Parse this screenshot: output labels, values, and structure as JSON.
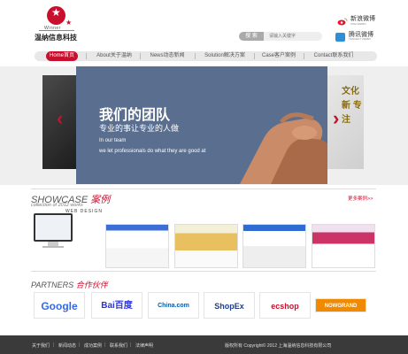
{
  "header": {
    "logo_english": "Winner",
    "logo_chinese": "温纳信息科技",
    "search_button": "搜 索",
    "search_placeholder": "请输入关键字",
    "weibo_label": "新浪微博",
    "weibo_sub": "SINA WEIBO",
    "tencent_label": "腾讯微博",
    "tencent_sub": "TENCENT WEIBO"
  },
  "nav": {
    "items": [
      {
        "label": "Home首页",
        "active": true
      },
      {
        "label": "About关于温纳"
      },
      {
        "label": "News动态新闻"
      },
      {
        "label": "Solution解决方案"
      },
      {
        "label": "Case客户案例"
      },
      {
        "label": "Contact联系我们"
      }
    ]
  },
  "banner": {
    "title": "我们的团队",
    "subtitle": "专业的事让专业的人做",
    "line1": "In our team",
    "line2": "we let professionals do what they are good at",
    "right_peek_text": "文化 新 专注",
    "prev_arrow": "‹",
    "next_arrow": "›"
  },
  "showcase": {
    "title_en": "SHOWCASE",
    "title_cn": "案例",
    "sub": "collection of 2012 works",
    "sub2": "WEB DESIGN",
    "more": "更多案例>>"
  },
  "partners": {
    "title_en": "PARTNERS",
    "title_cn": "合作伙伴",
    "logos": [
      "Google",
      "Bai百度",
      "China.com",
      "ShopEx",
      "ecshop",
      "NOWGRAND"
    ]
  },
  "footer": {
    "links": [
      "关于我们",
      "新闻动态",
      "成功案例",
      "联系我们",
      "法律声明"
    ],
    "copyright": "版权所有 Copyright© 2012 上海温纳信息科技有限公司"
  },
  "colors": {
    "accent": "#c8102e",
    "banner_blue": "#5a6f8f",
    "footer_bg": "#3a3a3a"
  }
}
